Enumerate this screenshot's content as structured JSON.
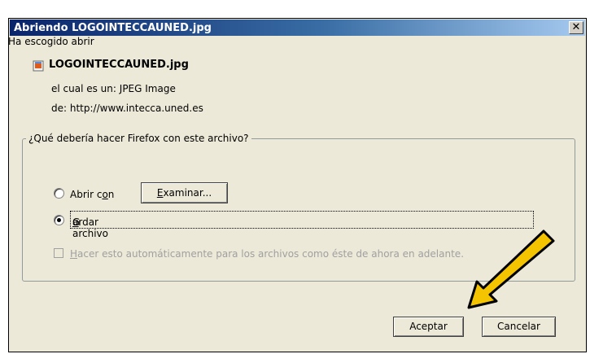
{
  "window": {
    "title": "Abriendo LOGOINTECCAUNED.jpg",
    "close_glyph": "✕"
  },
  "dialog": {
    "chosen_label": "Ha escogido abrir",
    "file_name": "LOGOINTECCAUNED.jpg",
    "file_icon": "jpeg-file-icon",
    "type_label": "el cual es un:",
    "type_value": "JPEG Image",
    "from_label": "de:",
    "from_value": "http://www.intecca.uned.es",
    "group_label": "¿Qué debería hacer Firefox con este archivo?",
    "open_with_pre": "Abrir c",
    "open_with_u": "o",
    "open_with_post": "n",
    "browse_u": "E",
    "browse_rest": "xaminar...",
    "save_pre": "G",
    "save_u": "u",
    "save_post": "ardar archivo",
    "auto_u": "H",
    "auto_rest": "acer esto automáticamente para los archivos como éste de ahora en adelante.",
    "selected_option": "Guardar archivo",
    "auto_checked": false,
    "ok_label": "Aceptar",
    "cancel_label": "Cancelar"
  },
  "annotation": {
    "arrow_color": "#f5c400",
    "arrow_outline": "#000000"
  }
}
